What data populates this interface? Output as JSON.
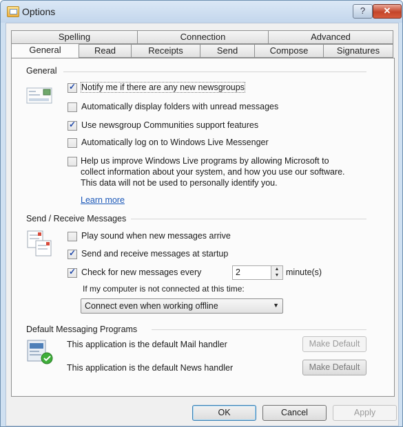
{
  "window": {
    "title": "Options",
    "help_glyph": "?",
    "close_glyph": "✕"
  },
  "tabs_row1": [
    {
      "label": "Spelling"
    },
    {
      "label": "Connection"
    },
    {
      "label": "Advanced"
    }
  ],
  "tabs_row2": [
    {
      "label": "General",
      "active": true
    },
    {
      "label": "Read"
    },
    {
      "label": "Receipts"
    },
    {
      "label": "Send"
    },
    {
      "label": "Compose"
    },
    {
      "label": "Signatures"
    }
  ],
  "general": {
    "title": "General",
    "notify": {
      "label": "Notify me if there are any new newsgroups",
      "checked": true
    },
    "auto_display": {
      "label": "Automatically display folders with unread messages",
      "checked": false
    },
    "communities": {
      "label": "Use newsgroup Communities support features",
      "checked": true
    },
    "auto_logon": {
      "label": "Automatically log on to Windows Live Messenger",
      "checked": false
    },
    "improve": {
      "checked": false,
      "line1": "Help us improve Windows Live programs by allowing Microsoft to",
      "line2": "collect information about your system, and how you use our software.",
      "line3": "This data will not be used to personally identify you."
    },
    "learn_more": "Learn more"
  },
  "send_receive": {
    "title": "Send / Receive Messages",
    "play_sound": {
      "label": "Play sound when new messages arrive",
      "checked": false
    },
    "send_startup": {
      "label": "Send and receive messages at startup",
      "checked": true
    },
    "check_every": {
      "label": "Check for new messages every",
      "checked": true,
      "value": "2",
      "unit": "minute(s)"
    },
    "not_connected_label": "If my computer is not connected at this time:",
    "connect_option": "Connect even when working offline"
  },
  "default_programs": {
    "title": "Default Messaging Programs",
    "mail_text": "This application is the default Mail handler",
    "news_text": "This application is the default News handler",
    "make_default_label": "Make Default"
  },
  "buttons": {
    "ok": "OK",
    "cancel": "Cancel",
    "apply": "Apply"
  }
}
